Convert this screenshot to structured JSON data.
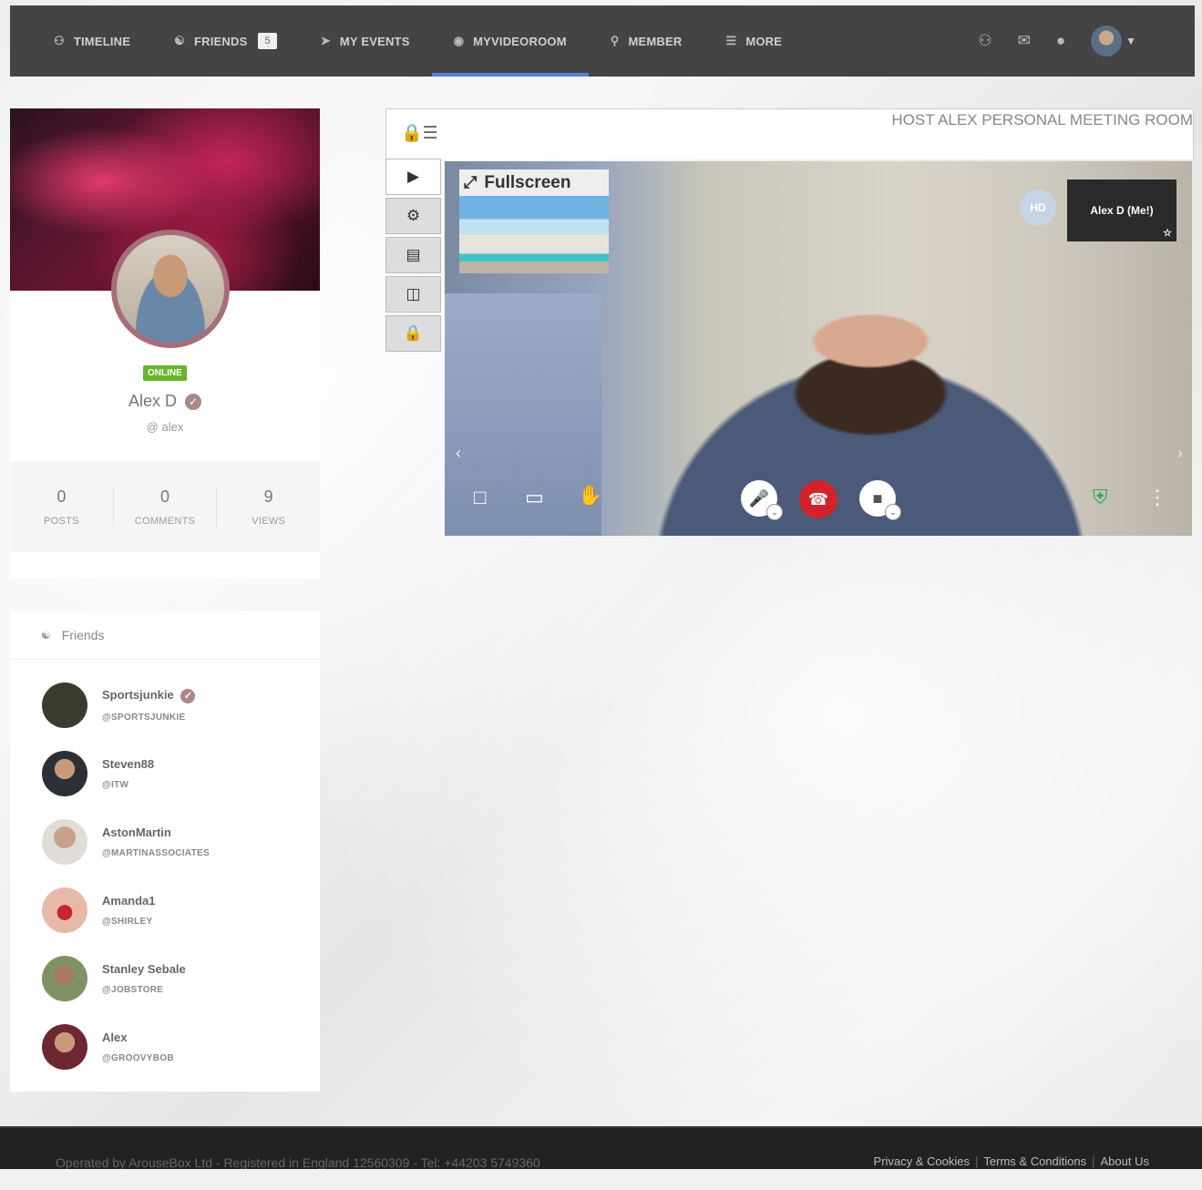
{
  "nav": {
    "items": [
      {
        "label": "TIMELINE",
        "icon": "users-icon"
      },
      {
        "label": "FRIENDS",
        "icon": "handshake-icon",
        "badge": "5"
      },
      {
        "label": "MY EVENTS",
        "icon": "rocket-icon"
      },
      {
        "label": "MYVIDEOROOM",
        "icon": "globe-icon",
        "active": true
      },
      {
        "label": "MEMBER",
        "icon": "search-icon"
      },
      {
        "label": "MORE",
        "icon": "menu-icon"
      }
    ],
    "right_icons": [
      "group-icon",
      "mail-icon",
      "globe-icon"
    ]
  },
  "profile": {
    "status": "ONLINE",
    "name": "Alex D",
    "handle": "@ alex",
    "stats": [
      {
        "value": "0",
        "label": "POSTS"
      },
      {
        "value": "0",
        "label": "COMMENTS"
      },
      {
        "value": "9",
        "label": "VIEWS"
      }
    ]
  },
  "friends": {
    "title": "Friends",
    "list": [
      {
        "name": "Sportsjunkie",
        "handle": "@SPORTSJUNKIE",
        "verified": true,
        "color": "#3a3d2c"
      },
      {
        "name": "Steven88",
        "handle": "@ITW",
        "verified": false,
        "color": "#444a55"
      },
      {
        "name": "AstonMartin",
        "handle": "@MARTINASSOCIATES",
        "verified": false,
        "color": "#c9a88e"
      },
      {
        "name": "Amanda1",
        "handle": "@SHIRLEY",
        "verified": false,
        "color": "#b43a3a"
      },
      {
        "name": "Stanley Sebale",
        "handle": "@JOBSTORE",
        "verified": false,
        "color": "#6b7a58"
      },
      {
        "name": "Alex",
        "handle": "@GROOVYBOB",
        "verified": false,
        "color": "#7a5a4a"
      }
    ]
  },
  "room": {
    "title": "HOST ALEX PERSONAL MEETING ROOM",
    "fullscreen_label": "Fullscreen",
    "hd_label": "HD",
    "self_label": "Alex D (Me!)"
  },
  "footer": {
    "operator": "Operated by ArouseBox Ltd - Registered in England 12560309 - Tel: +44203 5749360",
    "links": [
      "Privacy & Cookies",
      "Terms & Conditions",
      "About Us"
    ]
  },
  "colors": {
    "nav_bg": "#444444",
    "active_tab": "#5b7fd6",
    "online": "#69b52e",
    "hangup": "#d2232a"
  }
}
